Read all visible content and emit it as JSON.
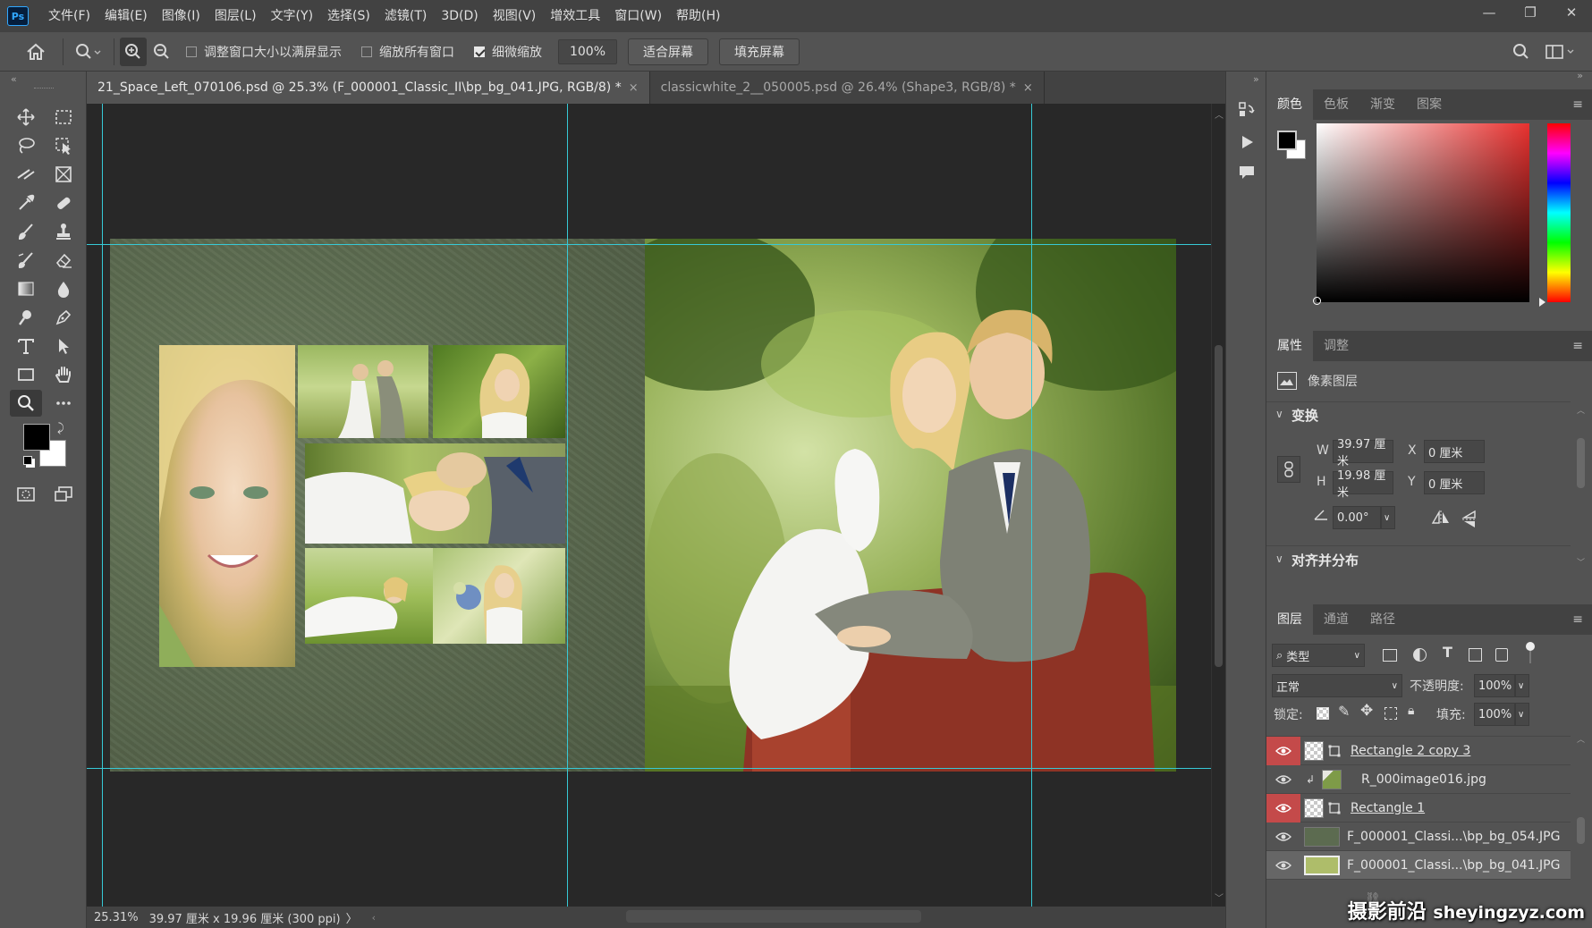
{
  "app": {
    "logo": "Ps"
  },
  "menu": [
    "文件(F)",
    "编辑(E)",
    "图像(I)",
    "图层(L)",
    "文字(Y)",
    "选择(S)",
    "滤镜(T)",
    "3D(D)",
    "视图(V)",
    "增效工具",
    "窗口(W)",
    "帮助(H)"
  ],
  "window_controls": {
    "minimize": "—",
    "restore": "❐",
    "close": "✕"
  },
  "options": {
    "resize_windows_label": "调整窗口大小以满屏显示",
    "resize_windows_checked": false,
    "zoom_all_label": "缩放所有窗口",
    "zoom_all_checked": false,
    "scrubby_label": "细微缩放",
    "scrubby_checked": true,
    "zoom_value": "100%",
    "fit_screen": "适合屏幕",
    "fill_screen": "填充屏幕"
  },
  "tabs": [
    {
      "label": "21_Space_Left_070106.psd @ 25.3% (F_000001_Classic_II\\bp_bg_041.JPG, RGB/8) *",
      "close": "×",
      "active": true
    },
    {
      "label": "classicwhite_2__050005.psd @ 26.4% (Shape3, RGB/8) *",
      "close": "×",
      "active": false
    }
  ],
  "status": {
    "zoom": "25.31%",
    "doc_size": "39.97 厘米 x 19.96 厘米 (300 ppi)",
    "arrow": "〉"
  },
  "color_panel": {
    "tabs": [
      "颜色",
      "色板",
      "渐变",
      "图案"
    ],
    "foreground": "#000000",
    "background": "#ffffff",
    "hue": "#e8312f"
  },
  "properties_panel": {
    "tabs": [
      "属性",
      "调整"
    ],
    "layer_type": "像素图层",
    "transform_title": "变换",
    "w_label": "W",
    "w_value": "39.97 厘米",
    "h_label": "H",
    "h_value": "19.98 厘米",
    "x_label": "X",
    "x_value": "0 厘米",
    "y_label": "Y",
    "y_value": "0 厘米",
    "angle_value": "0.00°",
    "align_title": "对齐并分布"
  },
  "layers_panel": {
    "tabs": [
      "图层",
      "通道",
      "路径"
    ],
    "filter_label": "类型",
    "blend_mode": "正常",
    "opacity_label": "不透明度:",
    "opacity_value": "100%",
    "lock_label": "锁定:",
    "fill_label": "填充:",
    "fill_value": "100%",
    "layers": [
      {
        "name": "Rectangle 2 copy 3",
        "eye_highlight": true,
        "type": "shape"
      },
      {
        "name": "R_000image016.jpg",
        "eye_highlight": false,
        "type": "clipped-image"
      },
      {
        "name": "Rectangle 1",
        "eye_highlight": true,
        "type": "shape"
      },
      {
        "name": "F_000001_Classi...\\bp_bg_054.JPG",
        "eye_highlight": false,
        "type": "image"
      },
      {
        "name": "F_000001_Classi...\\bp_bg_041.JPG",
        "eye_highlight": false,
        "type": "image-selected"
      }
    ]
  },
  "watermark": {
    "text": "摄影前沿",
    "url": "sheyingzyz.com"
  }
}
